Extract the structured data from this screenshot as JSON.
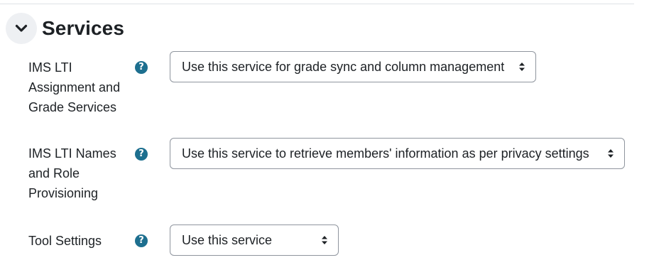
{
  "section": {
    "title": "Services",
    "toggle_icon": "chevron-down-icon"
  },
  "fields": [
    {
      "label_lines": [
        "IMS LTI",
        "Assignment and",
        "Grade Services"
      ],
      "help_icon": "question-circle-icon",
      "selected": "Use this service for grade sync and column management"
    },
    {
      "label_lines": [
        "IMS LTI Names",
        "and Role",
        "Provisioning"
      ],
      "help_icon": "question-circle-icon",
      "selected": "Use this service to retrieve members' information as per privacy settings"
    },
    {
      "label_lines": [
        "Tool Settings"
      ],
      "help_icon": "question-circle-icon",
      "selected": "Use this service"
    }
  ],
  "colors": {
    "help_icon": "#1d6f8f",
    "toggle_bg": "#eef0f3",
    "select_border": "#8f959e",
    "text": "#1d2125"
  }
}
